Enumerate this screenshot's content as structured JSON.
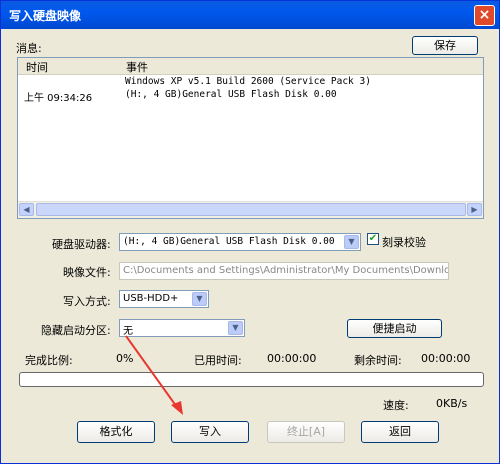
{
  "window": {
    "title": "写入硬盘映像",
    "close_symbol": "×"
  },
  "messages": {
    "label": "消息:",
    "save_label": "保存",
    "columns": [
      "时间",
      "事件"
    ],
    "rows": [
      {
        "time": "",
        "event": "Windows XP v5.1 Build 2600 (Service Pack 3)"
      },
      {
        "time": "上午 09:34:26",
        "event": "(H:, 4 GB)General USB Flash Disk  0.00"
      }
    ]
  },
  "form": {
    "drive_label": "硬盘驱动器:",
    "drive_value": "(H:, 4 GB)General USB Flash Disk  0.00",
    "verify_label": "刻录校验",
    "verify_checked": true,
    "image_label": "映像文件:",
    "image_value": "C:\\Documents and Settings\\Administrator\\My Documents\\Downlo",
    "method_label": "写入方式:",
    "method_value": "USB-HDD+",
    "hidden_label": "隐藏启动分区:",
    "hidden_value": "无",
    "quick_boot_label": "便捷启动"
  },
  "progress": {
    "ratio_label": "完成比例:",
    "ratio_value": "0%",
    "elapsed_label": "已用时间:",
    "elapsed_value": "00:00:00",
    "remaining_label": "剩余时间:",
    "remaining_value": "00:00:00",
    "speed_label": "速度:",
    "speed_value": "0KB/s",
    "fraction": 0
  },
  "buttons": {
    "format": "格式化",
    "write": "写入",
    "stop": "终止[A]",
    "back": "返回"
  },
  "colors": {
    "annotation_arrow": "#E8372E"
  }
}
